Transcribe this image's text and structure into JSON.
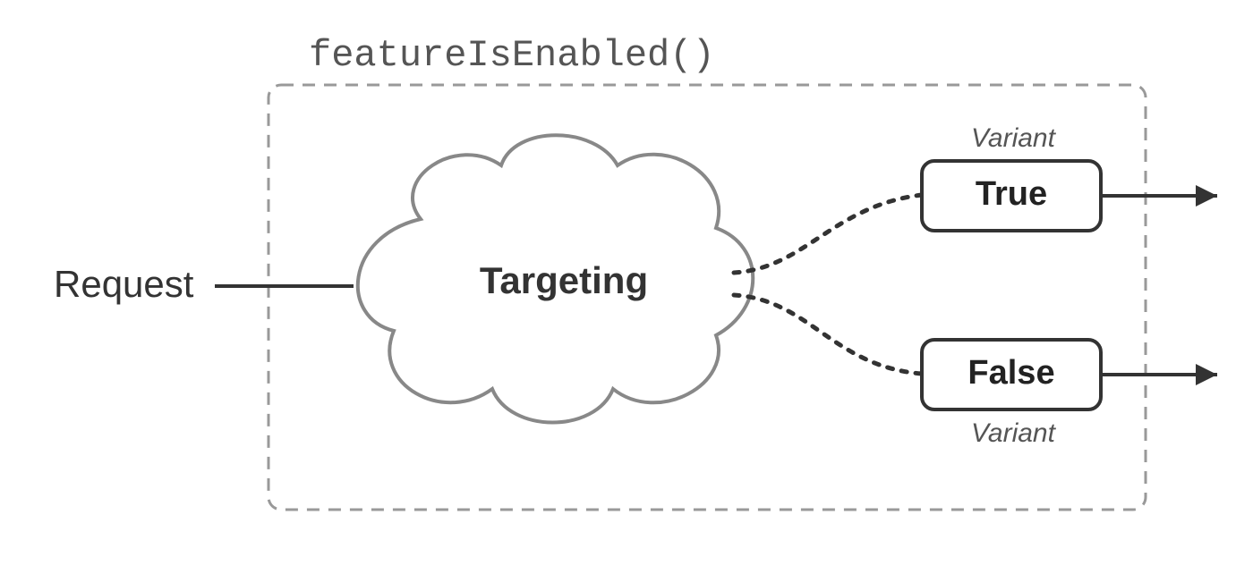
{
  "title": "featureIsEnabled()",
  "input_label": "Request",
  "cloud_label": "Targeting",
  "variant_top": {
    "caption": "Variant",
    "value": "True"
  },
  "variant_bottom": {
    "caption": "Variant",
    "value": "False"
  }
}
